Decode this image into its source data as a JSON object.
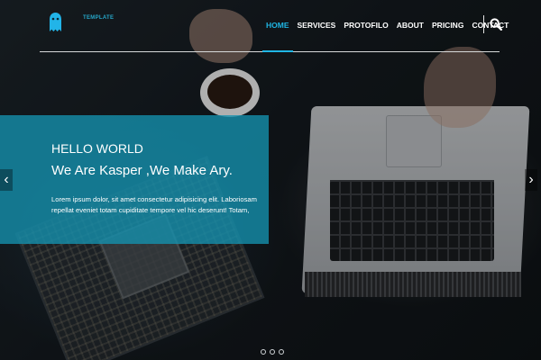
{
  "brand": {
    "logo_icon": "ghost-icon",
    "name": "TEMPLATE",
    "accent_color": "#1fb6e4"
  },
  "nav": {
    "items": [
      {
        "label": "HOME",
        "active": true
      },
      {
        "label": "SERVICES",
        "active": false
      },
      {
        "label": "PROTOFILO",
        "active": false
      },
      {
        "label": "ABOUT",
        "active": false
      },
      {
        "label": "PRICING",
        "active": false
      },
      {
        "label": "CONTACT",
        "active": false
      }
    ],
    "search_icon": "search-icon"
  },
  "slider": {
    "caption_color": "#1592af",
    "title": "HELLO WORLD",
    "subtitle": "We Are Kasper ,We Make Ary.",
    "body": "Lorem ipsum dolor, sit amet consectetur adipisicing elit. Laboriosam repellat eveniet totam cupiditate tempore vel hic deserunt! Totam,",
    "prev_icon": "chevron-left-icon",
    "next_icon": "chevron-right-icon",
    "dots": [
      {
        "active": false
      },
      {
        "active": false
      },
      {
        "active": false
      }
    ]
  }
}
